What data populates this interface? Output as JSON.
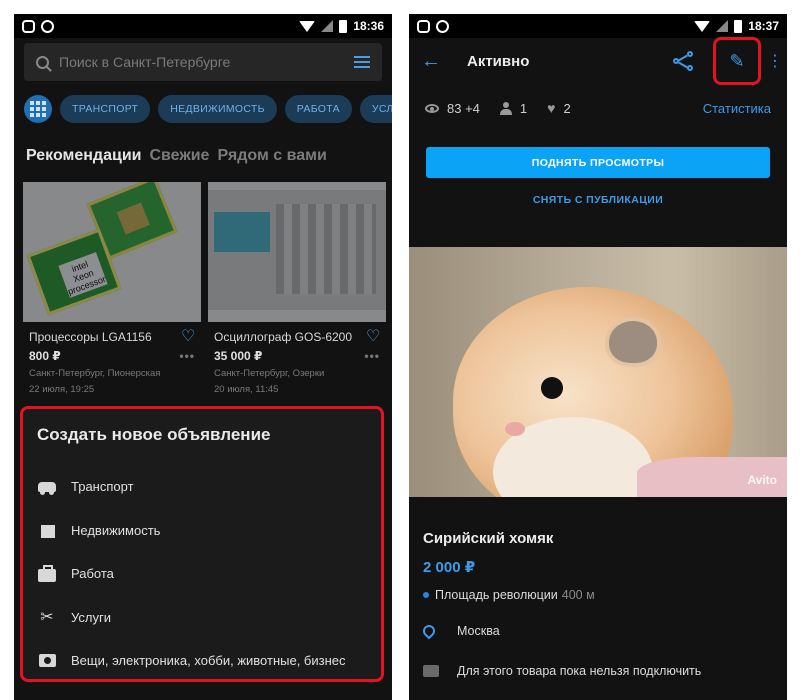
{
  "left": {
    "status": {
      "time": "18:36"
    },
    "search": {
      "placeholder": "Поиск в Санкт-Петербурге"
    },
    "chips": [
      "ТРАНСПОРТ",
      "НЕДВИЖИМОСТЬ",
      "РАБОТА",
      "УСЛУГИ"
    ],
    "tabs": [
      "Рекомендации",
      "Свежие",
      "Рядом с вами"
    ],
    "cards": [
      {
        "title": "Процессоры LGA1156",
        "price": "800 ₽",
        "location": "Санкт-Петербург, Пионерская",
        "date": "22 июля, 19:25",
        "image_text": "intel Xeon processor"
      },
      {
        "title": "Осциллограф GOS-6200",
        "price": "35 000 ₽",
        "location": "Санкт-Петербург, Озерки",
        "date": "20 июля, 11:45"
      }
    ],
    "sheet": {
      "title": "Создать новое объявление",
      "items": [
        {
          "label": "Транспорт",
          "icon": "car-icon"
        },
        {
          "label": "Недвижимость",
          "icon": "building-icon"
        },
        {
          "label": "Работа",
          "icon": "briefcase-icon"
        },
        {
          "label": "Услуги",
          "icon": "scissors-icon"
        },
        {
          "label": "Вещи, электроника, хобби, животные, бизнес",
          "icon": "camera-icon"
        }
      ]
    }
  },
  "right": {
    "status": {
      "time": "18:37"
    },
    "topbar": {
      "title": "Активно"
    },
    "stats": {
      "views": "83 +4",
      "contacts": "1",
      "favorites": "2",
      "stats_link": "Статистика"
    },
    "raise_label": "ПОДНЯТЬ ПРОСМОТРЫ",
    "unpublish_label": "СНЯТЬ С ПУБЛИКАЦИИ",
    "photo": {
      "watermark": "Avito"
    },
    "product": {
      "title": "Сирийский хомяк",
      "price": "2 000 ₽",
      "metro": "Площадь революции",
      "metro_distance": "400 м",
      "city": "Москва",
      "delivery": "Для этого товара пока нельзя подключить"
    }
  },
  "colors": {
    "accent": "#3d9be9",
    "highlight": "#e4131f",
    "button": "#0aa3f5",
    "background": "#121212"
  }
}
